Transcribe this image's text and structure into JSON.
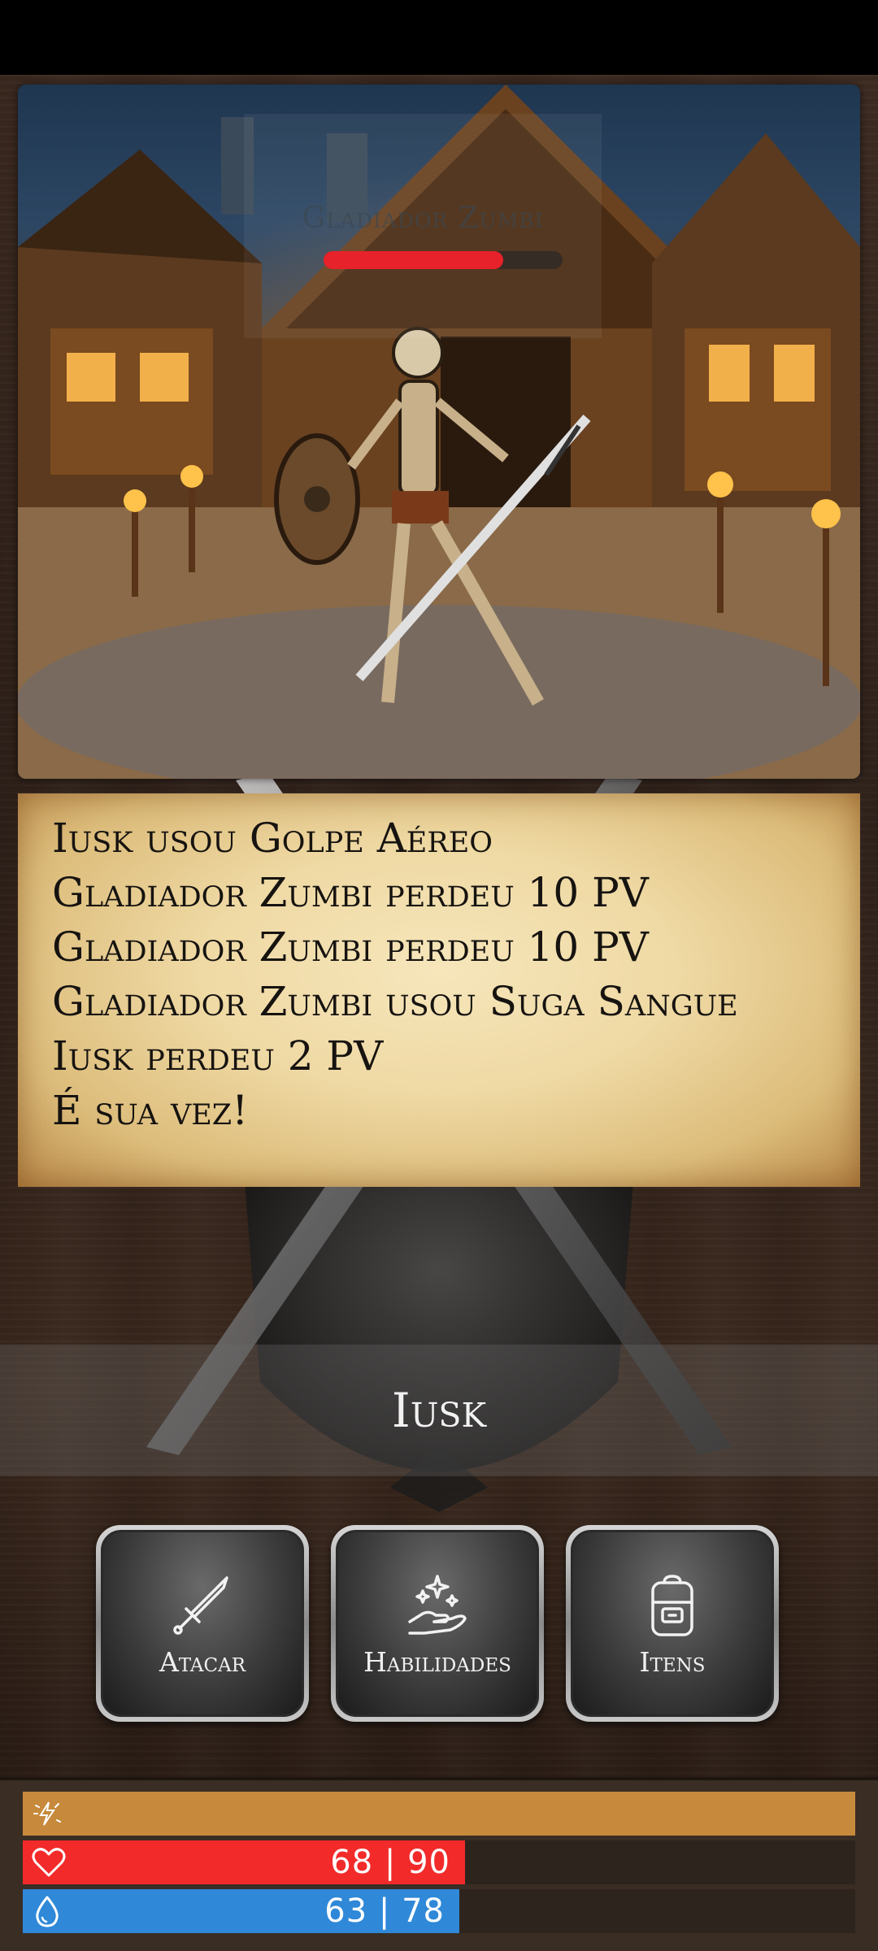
{
  "enemy": {
    "name": "Gladiador Zumbi",
    "hp_fraction": 0.75
  },
  "log": [
    "Iusk usou Golpe Aéreo",
    "Gladiador Zumbi perdeu 10 PV",
    "Gladiador Zumbi perdeu 10 PV",
    "Gladiador Zumbi usou Suga Sangue",
    "Iusk perdeu 2 PV",
    "É sua vez!"
  ],
  "player": {
    "name": "Iusk"
  },
  "actions": {
    "attack_label": "Atacar",
    "skills_label": "Habilidades",
    "items_label": "Itens"
  },
  "stats": {
    "energy": {
      "icon": "energy-icon",
      "fraction": 1.0,
      "color": "#c78a3c"
    },
    "health": {
      "icon": "heart-icon",
      "current": 68,
      "max": 90,
      "text": "68 | 90",
      "color": "#f22a2a"
    },
    "mana": {
      "icon": "water-drop-icon",
      "current": 63,
      "max": 78,
      "text": "63 | 78",
      "color": "#2f88d8"
    }
  },
  "colors": {
    "enemy_hp": "#e8222a",
    "parchment": "#efd9a4"
  }
}
